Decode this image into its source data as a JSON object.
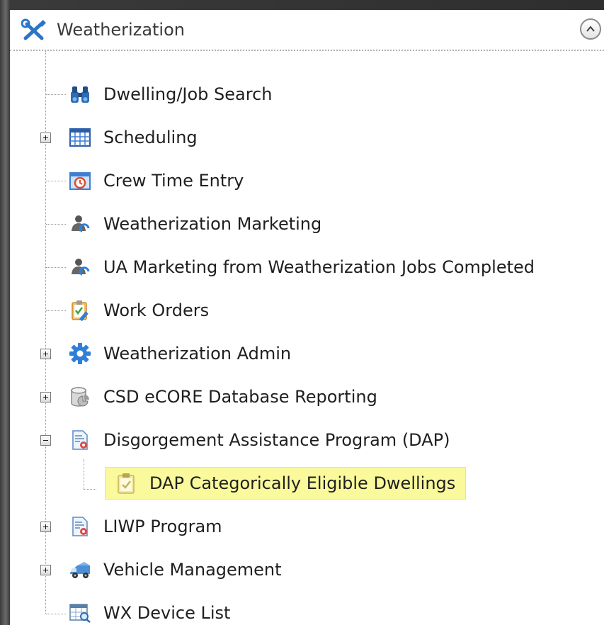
{
  "panel": {
    "title": "Weatherization",
    "header_icon": "tools-icon",
    "collapse_icon": "chevron-up-circle-icon"
  },
  "tree": {
    "items": [
      {
        "label": "Dwelling/Job Search",
        "icon": "binoculars-icon",
        "expander": "none"
      },
      {
        "label": "Scheduling",
        "icon": "calendar-grid-icon",
        "expander": "plus"
      },
      {
        "label": "Crew Time Entry",
        "icon": "clock-calendar-icon",
        "expander": "none"
      },
      {
        "label": "Weatherization Marketing",
        "icon": "user-arrow-icon",
        "expander": "none"
      },
      {
        "label": "UA Marketing from Weatherization Jobs Completed",
        "icon": "user-arrow-icon",
        "expander": "none"
      },
      {
        "label": "Work Orders",
        "icon": "clipboard-pencil-icon",
        "expander": "none"
      },
      {
        "label": "Weatherization Admin",
        "icon": "gear-icon",
        "expander": "plus"
      },
      {
        "label": "CSD eCORE Database Reporting",
        "icon": "database-report-icon",
        "expander": "plus"
      },
      {
        "label": "Disgorgement Assistance Program (DAP)",
        "icon": "document-ribbon-icon",
        "expander": "minus",
        "children": [
          {
            "label": "DAP Categorically Eligible Dwellings",
            "icon": "clipboard-check-icon",
            "selected": true
          }
        ]
      },
      {
        "label": "LIWP Program",
        "icon": "document-ribbon-icon",
        "expander": "plus"
      },
      {
        "label": "Vehicle Management",
        "icon": "truck-icon",
        "expander": "plus"
      },
      {
        "label": "WX Device List",
        "icon": "table-search-icon",
        "expander": "none"
      }
    ]
  },
  "colors": {
    "selected_bg": "#fafa9c",
    "gear_blue": "#2f7fd8",
    "backdrop": "#3a3a3a"
  }
}
